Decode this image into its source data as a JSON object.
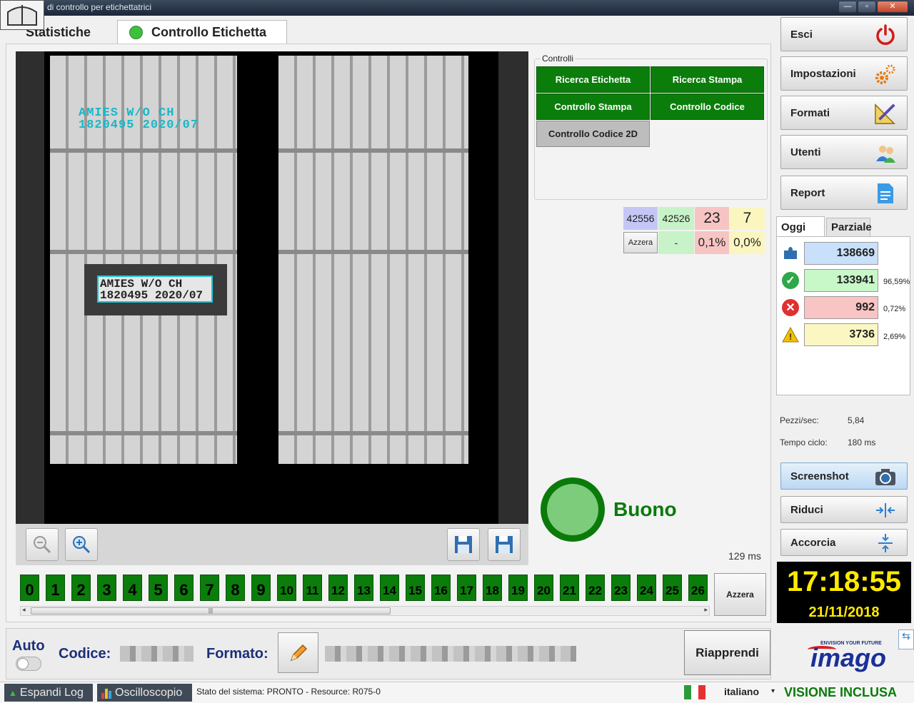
{
  "window": {
    "title": "di controllo per etichettatrici",
    "buttons": {
      "minimize": "—",
      "maximize": "▫",
      "close": "✕"
    }
  },
  "tabs": {
    "stats": "Statistiche",
    "control": "Controllo Etichetta"
  },
  "viewer": {
    "print_left": [
      "AMIES W/O CH",
      "1820495 2020/07"
    ],
    "ocr_result": [
      "AMIES W/O CH",
      "1820495 2020/07"
    ],
    "tools": {
      "zoom_out": "zoom-out-icon",
      "zoom_in": "zoom-in-icon",
      "save_image": "save-image-icon",
      "save_image_alt": "save-image-icon"
    }
  },
  "controlli": {
    "title": "Controlli",
    "buttons": [
      {
        "label": "Ricerca Etichetta",
        "state": "ok"
      },
      {
        "label": "Ricerca Stampa",
        "state": "ok"
      },
      {
        "label": "Controllo Stampa",
        "state": "ok"
      },
      {
        "label": "Controllo Codice",
        "state": "ok"
      },
      {
        "label": "Controllo Codice 2D",
        "state": "disabled"
      }
    ]
  },
  "counters": {
    "total": "42556",
    "good": "42526",
    "bad": "23",
    "warn": "7",
    "azzera": "Azzera",
    "good_pct": "-",
    "bad_pct": "0,1%",
    "warn_pct": "0,0%"
  },
  "result": {
    "text": "Buono",
    "time": "129 ms",
    "color": "#0a7a0a"
  },
  "channels": {
    "items": [
      "0",
      "1",
      "2",
      "3",
      "4",
      "5",
      "6",
      "7",
      "8",
      "9",
      "10",
      "11",
      "12",
      "13",
      "14",
      "15",
      "16",
      "17",
      "18",
      "19",
      "20",
      "21",
      "22",
      "23",
      "24",
      "25",
      "26"
    ],
    "reset": "Azzera",
    "scroll_grip": "|||",
    "scroll_left": "◂",
    "scroll_right": "▸"
  },
  "bottom": {
    "auto": "Auto",
    "codice_label": "Codice:",
    "formato_label": "Formato:",
    "riapprendi": "Riapprendi"
  },
  "statusbar": {
    "expand_log": "Espandi Log",
    "oscilloscope": "Oscilloscopio",
    "status": "Stato del sistema: PRONTO - Resource: R075-0",
    "language": "italiano",
    "language_arrow": "▾",
    "visione": "VISIONE INCLUSA"
  },
  "sidebar": {
    "buttons": [
      {
        "label": "Esci",
        "icon": "power-icon"
      },
      {
        "label": "Impostazioni",
        "icon": "gears-icon"
      },
      {
        "label": "Formati",
        "icon": "ruler-pencil-icon"
      },
      {
        "label": "Utenti",
        "icon": "users-icon"
      },
      {
        "label": "Report",
        "icon": "document-icon"
      }
    ],
    "stats_tabs": {
      "today": "Oggi",
      "partial": "Parziale"
    },
    "stats": {
      "total": "138669",
      "good": "133941",
      "good_pct": "96,59%",
      "bad": "992",
      "bad_pct": "0,72%",
      "warn": "3736",
      "warn_pct": "2,69%"
    },
    "rate_label": "Pezzi/sec:",
    "rate_value": "5,84",
    "cycle_label": "Tempo ciclo:",
    "cycle_value": "180 ms",
    "tool_buttons": [
      {
        "label": "Screenshot",
        "icon": "camera-icon"
      },
      {
        "label": "Riduci",
        "icon": "shrink-horizontal-icon"
      },
      {
        "label": "Accorcia",
        "icon": "shrink-vertical-icon"
      }
    ],
    "clock_time": "17:18:55",
    "clock_date": "21/11/2018",
    "logo_word": "imago",
    "logo_tag": "ENVISION YOUR FUTURE"
  },
  "colors": {
    "ok_green": "#0b7d0b",
    "count_blue": "#c6c6f6",
    "count_green": "#c8f2c8",
    "count_red": "#f7c4c4",
    "count_yellow": "#fbf6c0",
    "stat_blue": "#c9e0fb",
    "stat_green": "#c8f7c8",
    "stat_red": "#f8c4c4",
    "stat_yellow": "#fbf7c2"
  }
}
